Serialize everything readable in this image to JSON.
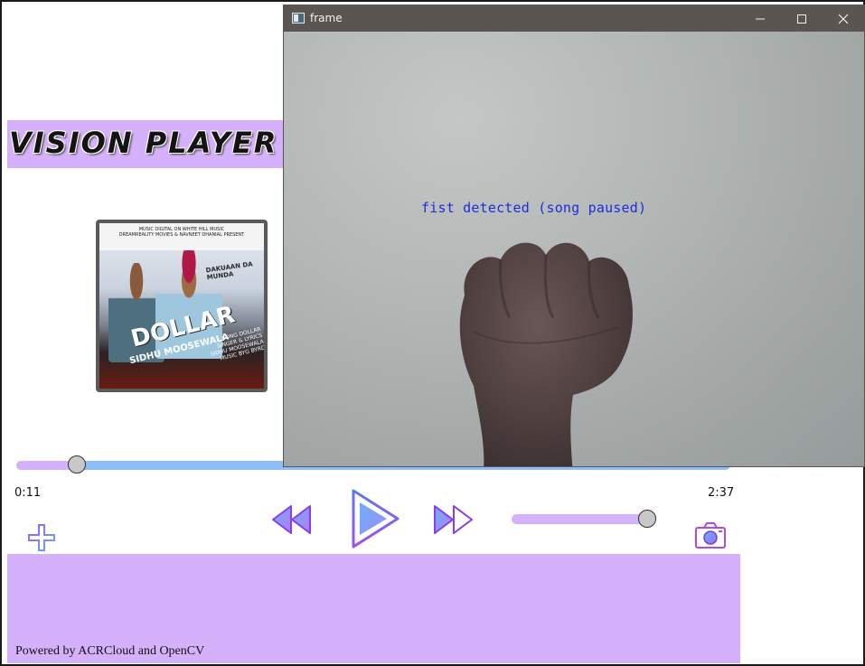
{
  "app": {
    "logo_text": "VISION PLAYER",
    "accent_color": "#d6b1fb",
    "progress_color": "#8cbff7"
  },
  "album": {
    "title": "DOLLAR",
    "artist": "SIDHU MOOSEWALA",
    "top_text": "MUSIC DIGITAL ON WHITE HILL MUSIC\nDREAMREALITY MOVIES & NAVNEET DHANIAL PRESENT",
    "subtitle": "DAKUAAN DA MUNDA",
    "credits": "SONG DOLLAR\nSINGER & LYRICS SIDHU MOOSEWALA\nMUSIC BYG BYRD"
  },
  "player": {
    "elapsed": "0:11",
    "duration": "2:37",
    "progress_fraction": 0.085,
    "volume_fraction": 1.0,
    "controls": {
      "add": "plus-icon",
      "rewind": "rewind-icon",
      "play": "play-icon",
      "fast_forward": "fast-forward-icon",
      "camera": "camera-icon"
    }
  },
  "footer": {
    "icon": "audio-wave-icon",
    "credit_text": "Powered by ACRCloud and OpenCV"
  },
  "camera_window": {
    "title": "frame",
    "detection_text": "fist detected (song paused)",
    "detection_color": "#1d2ce0"
  }
}
